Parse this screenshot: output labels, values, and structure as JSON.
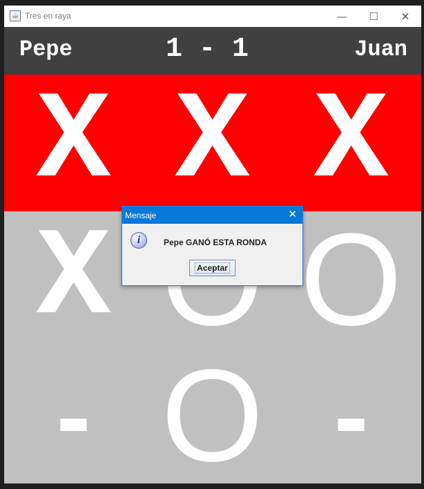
{
  "window": {
    "title": "Tres en raya",
    "app_icon": "java-cup-icon"
  },
  "scoreboard": {
    "player1": "Pepe",
    "score": "1 - 1",
    "player2": "Juan"
  },
  "board": {
    "colors": {
      "win": "#ff0000",
      "board": "#c0c0c0",
      "mark": "#ffffff",
      "header": "#404040"
    },
    "winning_row": 0,
    "cells": [
      "X",
      "X",
      "X",
      "X",
      "O",
      "O",
      "-",
      "O",
      "-"
    ]
  },
  "dialog": {
    "title": "Mensaje",
    "icon": "information-icon",
    "message": "Pepe GANÓ ESTA RONDA",
    "button_label": "Aceptar"
  }
}
